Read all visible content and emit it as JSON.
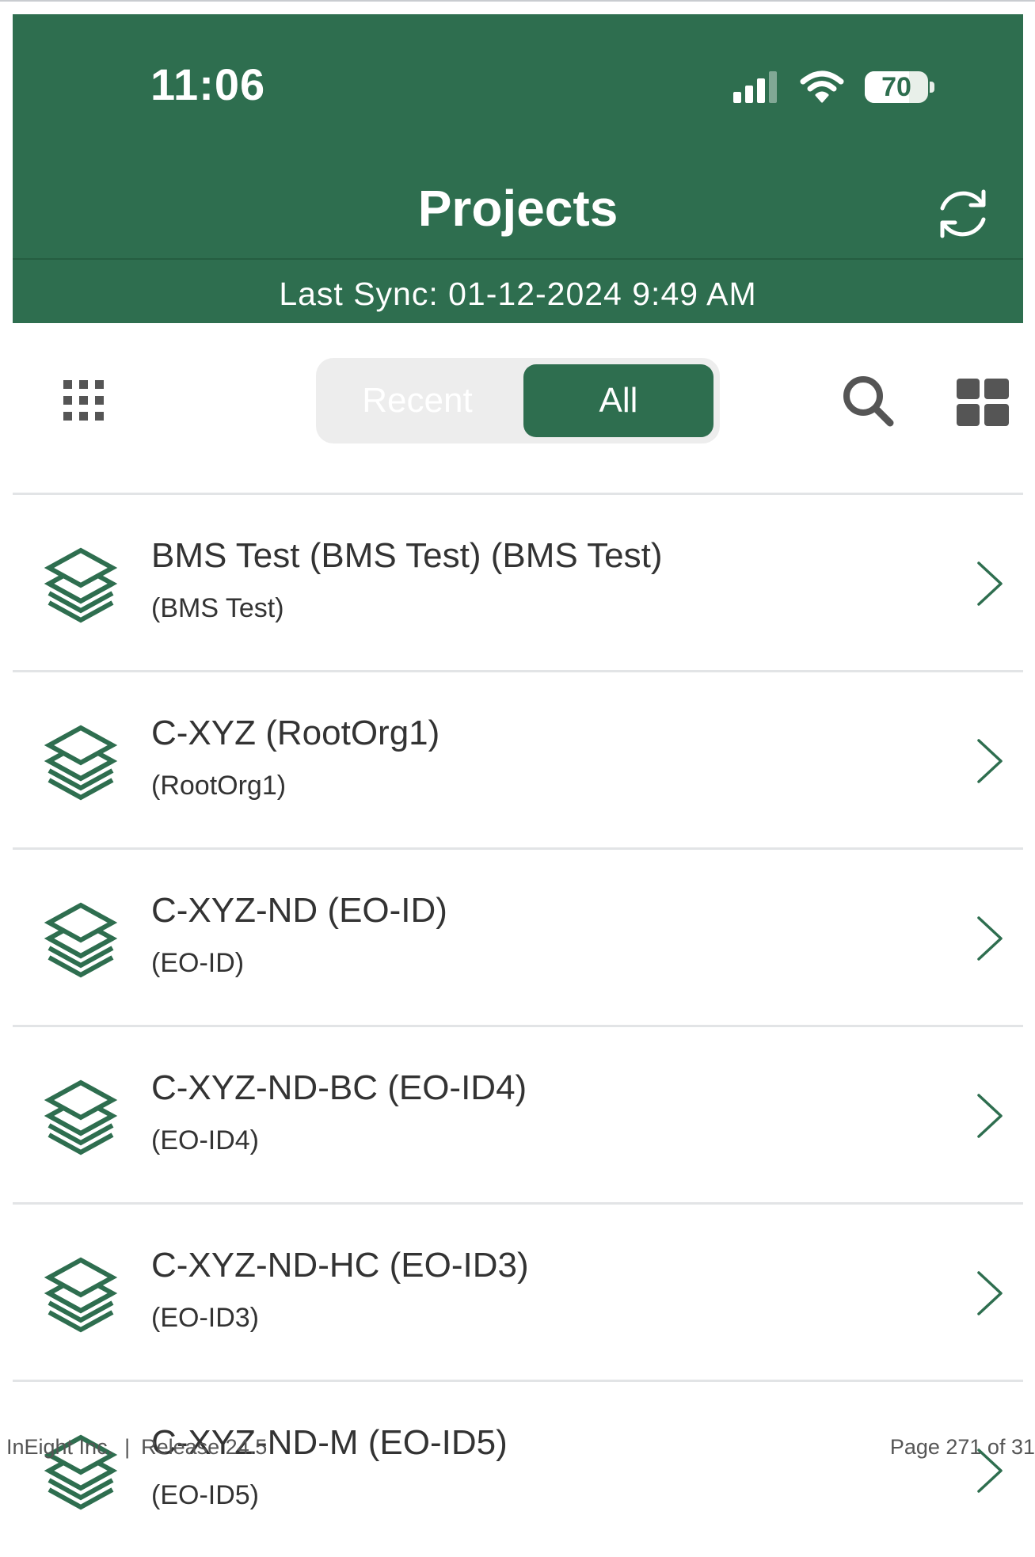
{
  "status_bar": {
    "time": "11:06",
    "battery": "70",
    "battery_level_percent": 70
  },
  "header": {
    "title": "Projects",
    "last_sync": "Last Sync: 01-12-2024 9:49 AM"
  },
  "toolbar": {
    "segments": [
      {
        "label": "Recent",
        "selected": false
      },
      {
        "label": "All",
        "selected": true
      }
    ]
  },
  "projects": [
    {
      "name": "BMS Test (BMS Test) (BMS Test)",
      "sub": "(BMS Test)"
    },
    {
      "name": "C-XYZ (RootOrg1)",
      "sub": "(RootOrg1)"
    },
    {
      "name": "C-XYZ-ND (EO-ID)",
      "sub": "(EO-ID)"
    },
    {
      "name": "C-XYZ-ND-BC (EO-ID4)",
      "sub": "(EO-ID4)"
    },
    {
      "name": "C-XYZ-ND-HC (EO-ID3)",
      "sub": "(EO-ID3)"
    },
    {
      "name": "C-XYZ-ND-M (EO-ID5)",
      "sub": "(EO-ID5)"
    }
  ],
  "footer": {
    "company": "InEight Inc.",
    "release": "Release 24.5",
    "page": "Page 271 of 31"
  },
  "colors": {
    "brand_green": "#2e6e4f",
    "divider": "#e2e4e6",
    "segment_bg": "#ededed"
  },
  "icons": [
    "signal-icon",
    "wifi-icon",
    "battery-icon",
    "sync-icon",
    "apps-grid-icon",
    "search-icon",
    "tile-view-icon",
    "project-layers-icon",
    "chevron-right-icon"
  ]
}
